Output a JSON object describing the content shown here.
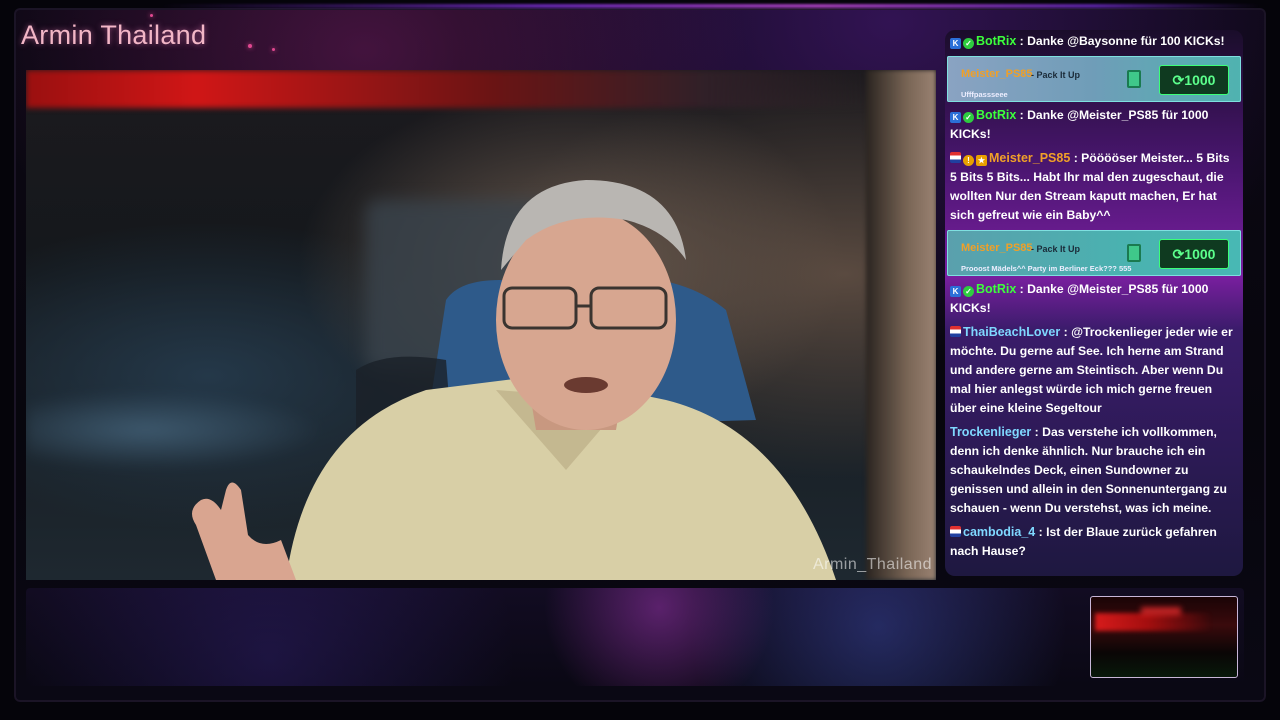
{
  "overlay": {
    "streamer_name": "Armin Thailand",
    "watermark": "Armin_Thailand"
  },
  "chat": {
    "messages": [
      {
        "type": "message",
        "badges": [
          "kick-badge",
          "verified-badge"
        ],
        "user": "BotRix",
        "user_color": "#3cff3c",
        "separator": ":",
        "text": "Danke @Baysonne für 100 KICKs!"
      },
      {
        "type": "tip",
        "user": "Meister_PS85",
        "action": "- Pack It Up",
        "message": "Ufffpassseee",
        "icon": "gift-icon",
        "amount": "1000"
      },
      {
        "type": "message",
        "badges": [
          "kick-badge",
          "verified-badge"
        ],
        "user": "BotRix",
        "user_color": "#3cff3c",
        "separator": ":",
        "text": "Danke @Meister_PS85 für 1000 KICKs!"
      },
      {
        "type": "message",
        "badges": [
          "thai-flag-badge",
          "warning-badge",
          "subscriber-badge"
        ],
        "user": "Meister_PS85",
        "user_color": "#f0a028",
        "separator": ":",
        "text": "Pööööser Meister... 5 Bits 5 Bits 5 Bits... Habt Ihr mal den zugeschaut, die wollten Nur den Stream kaputt machen, Er hat sich gefreut wie ein Baby^^"
      },
      {
        "type": "tip",
        "user": "Meister_PS85",
        "action": "- Pack It Up",
        "message": "Prooost Mädels^^ Party im Berliner Eck??? 555",
        "icon": "gift-icon",
        "amount": "1000"
      },
      {
        "type": "message",
        "badges": [
          "kick-badge",
          "verified-badge"
        ],
        "user": "BotRix",
        "user_color": "#3cff3c",
        "separator": ":",
        "text": "Danke @Meister_PS85 für 1000 KICKs!"
      },
      {
        "type": "message",
        "badges": [
          "thai-flag-badge"
        ],
        "user": "ThaiBeachLover",
        "user_color": "#7fd8ff",
        "separator": ":",
        "text": "@Trockenlieger jeder wie er möchte. Du gerne auf See. Ich herne am Strand und andere gerne am Steintisch. Aber wenn Du mal hier anlegst würde ich mich gerne freuen über eine kleine Segeltour"
      },
      {
        "type": "message",
        "badges": [],
        "user": "Trockenlieger",
        "user_color": "#7fd8ff",
        "separator": ":",
        "text": "Das verstehe ich vollkommen, denn ich denke ähnlich. Nur brauche ich ein schaukelndes Deck, einen Sundowner zu genissen und allein in den Sonnenuntergang zu schauen - wenn Du verstehst, was ich meine."
      },
      {
        "type": "message",
        "badges": [
          "thai-flag-badge"
        ],
        "user": "cambodia_4",
        "user_color": "#7fd8ff",
        "separator": ":",
        "text": "Ist der Blaue zurück gefahren nach Hause?"
      }
    ]
  },
  "colors": {
    "name_glow": "#f2b6c6",
    "botrix": "#3cff3c",
    "tip_amount": "#5cff8c",
    "accent_purple": "#7a1fa0"
  }
}
